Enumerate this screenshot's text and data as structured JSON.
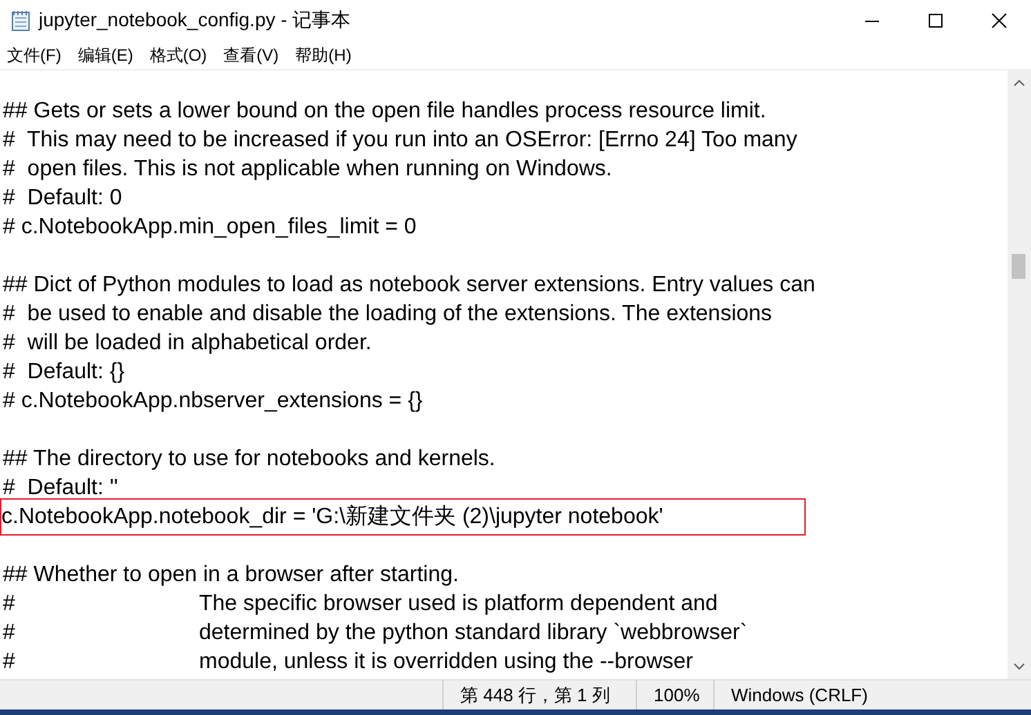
{
  "window": {
    "title": "jupyter_notebook_config.py - 记事本"
  },
  "menu": [
    {
      "label": "文件(F)"
    },
    {
      "label": "编辑(E)"
    },
    {
      "label": "格式(O)"
    },
    {
      "label": "查看(V)"
    },
    {
      "label": "帮助(H)"
    }
  ],
  "editor": {
    "blocks": [
      {
        "lines": [
          {
            "text": "## Gets or sets a lower bound on the open file handles process resource limit.",
            "boxed": false
          },
          {
            "text": "#  This may need to be increased if you run into an OSError: [Errno 24] Too many",
            "boxed": false
          },
          {
            "text": "#  open files. This is not applicable when running on Windows.",
            "boxed": false
          },
          {
            "text": "#  Default: 0",
            "boxed": false
          },
          {
            "text": "# c.NotebookApp.min_open_files_limit = 0",
            "boxed": false
          }
        ]
      },
      {
        "lines": [
          {
            "text": "## Dict of Python modules to load as notebook server extensions. Entry values can",
            "boxed": false
          },
          {
            "text": "#  be used to enable and disable the loading of the extensions. The extensions",
            "boxed": false
          },
          {
            "text": "#  will be loaded in alphabetical order.",
            "boxed": false
          },
          {
            "text": "#  Default: {}",
            "boxed": false
          },
          {
            "text": "# c.NotebookApp.nbserver_extensions = {}",
            "boxed": false
          }
        ]
      },
      {
        "lines": [
          {
            "text": "## The directory to use for notebooks and kernels.",
            "boxed": false
          },
          {
            "text": "#  Default: ''",
            "boxed": false
          },
          {
            "text": "c.NotebookApp.notebook_dir = 'G:\\新建文件夹 (2)\\jupyter notebook'",
            "boxed": true
          }
        ]
      },
      {
        "lines": [
          {
            "text": "## Whether to open in a browser after starting.",
            "boxed": false
          },
          {
            "text": "#\tThe specific browser used is platform dependent and",
            "boxed": false
          },
          {
            "text": "#\tdetermined by the python standard library `webbrowser`",
            "boxed": false
          },
          {
            "text": "#\tmodule, unless it is overridden using the --browser",
            "boxed": false
          }
        ]
      }
    ]
  },
  "status_bar": {
    "position": "第 448 行，第 1 列",
    "zoom": "100%",
    "encoding": "Windows (CRLF)"
  }
}
